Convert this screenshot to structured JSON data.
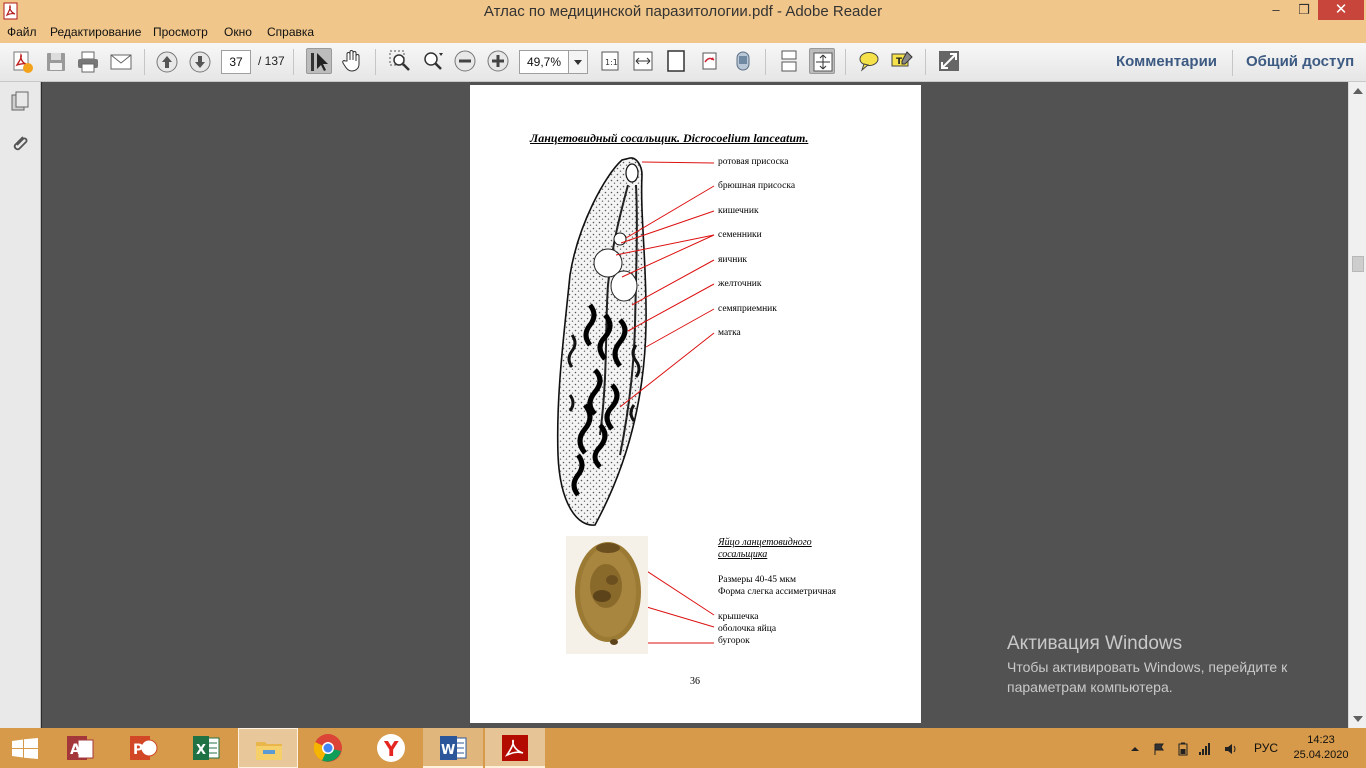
{
  "window": {
    "title": "Атлас по медицинской паразитологии.pdf - Adobe Reader",
    "minimize": "–",
    "maximize": "❒",
    "close": "✕"
  },
  "menu": {
    "items": [
      "Файл",
      "Редактирование",
      "Просмотр",
      "Окно",
      "Справка"
    ]
  },
  "toolbar": {
    "page_current": "37",
    "page_total": "/ 137",
    "zoom": "49,7%",
    "comments": "Комментарии",
    "share": "Общий доступ",
    "colors": {
      "accent_link": "#3c5a82"
    }
  },
  "document": {
    "heading": "Ланцетовидный сосальщик. Dicrocoelium lanceatum.",
    "labels": [
      "ротовая присоска",
      "брюшная присоска",
      "кишечник",
      "семенники",
      "яичник",
      "желточник",
      "семяприемник",
      "матка"
    ],
    "egg": {
      "title": "Яйцо ланцетовидного сосальщика",
      "size": "Размеры 40-45 мкм",
      "shape": "Форма слегка ассиметричная",
      "parts": [
        "крышечка",
        "оболочка яйца",
        "бугорок"
      ]
    },
    "page_number": "36"
  },
  "watermark": {
    "heading": "Активация Windows",
    "line1": "Чтобы активировать Windows, перейдите к",
    "line2": "параметрам компьютера."
  },
  "taskbar": {
    "apps": [
      "access-icon",
      "powerpoint-icon",
      "excel-icon",
      "file-explorer-icon",
      "chrome-icon",
      "yandex-browser-icon",
      "word-icon",
      "adobe-reader-icon"
    ],
    "lang": "РУС",
    "time": "14:23",
    "date": "25.04.2020"
  }
}
